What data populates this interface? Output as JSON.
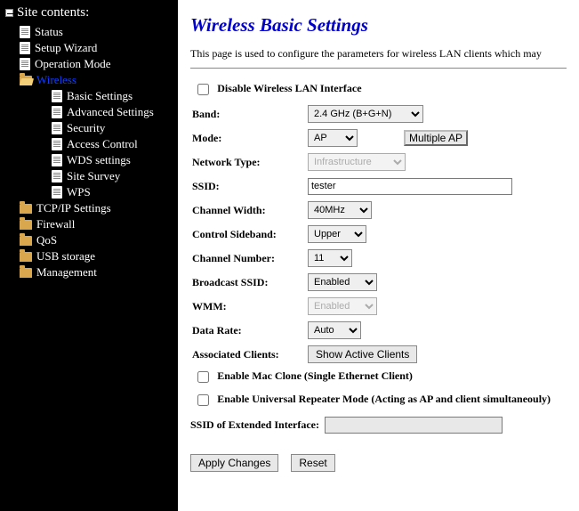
{
  "sidebar": {
    "heading": "Site contents:",
    "items": [
      {
        "label": "Status"
      },
      {
        "label": "Setup Wizard"
      },
      {
        "label": "Operation Mode"
      }
    ],
    "wireless": {
      "label": "Wireless",
      "children": [
        {
          "label": "Basic Settings"
        },
        {
          "label": "Advanced Settings"
        },
        {
          "label": "Security"
        },
        {
          "label": "Access Control"
        },
        {
          "label": "WDS settings"
        },
        {
          "label": "Site Survey"
        },
        {
          "label": "WPS"
        }
      ]
    },
    "after": [
      {
        "label": "TCP/IP Settings"
      },
      {
        "label": "Firewall"
      },
      {
        "label": "QoS"
      },
      {
        "label": "USB storage"
      },
      {
        "label": "Management"
      }
    ]
  },
  "page": {
    "title": "Wireless Basic Settings",
    "description": "This page is used to configure the parameters for wireless LAN clients which may",
    "disable_label": "Disable Wireless LAN Interface",
    "labels": {
      "band": "Band:",
      "mode": "Mode:",
      "network_type": "Network Type:",
      "ssid": "SSID:",
      "channel_width": "Channel Width:",
      "control_sideband": "Control Sideband:",
      "channel_number": "Channel Number:",
      "broadcast_ssid": "Broadcast SSID:",
      "wmm": "WMM:",
      "data_rate": "Data Rate:",
      "associated_clients": "Associated Clients:",
      "mac_clone": "Enable Mac Clone (Single Ethernet Client)",
      "repeater": "Enable Universal Repeater Mode (Acting as AP and client simultaneouly)",
      "extended": "SSID of Extended Interface:"
    },
    "values": {
      "band": "2.4 GHz (B+G+N)",
      "mode": "AP",
      "multiple_ap": "Multiple AP",
      "network_type": "Infrastructure",
      "ssid": "tester",
      "channel_width": "40MHz",
      "control_sideband": "Upper",
      "channel_number": "11",
      "broadcast_ssid": "Enabled",
      "wmm": "Enabled",
      "data_rate": "Auto",
      "show_clients": "Show Active Clients",
      "extended": ""
    },
    "actions": {
      "apply": "Apply Changes",
      "reset": "Reset"
    }
  }
}
